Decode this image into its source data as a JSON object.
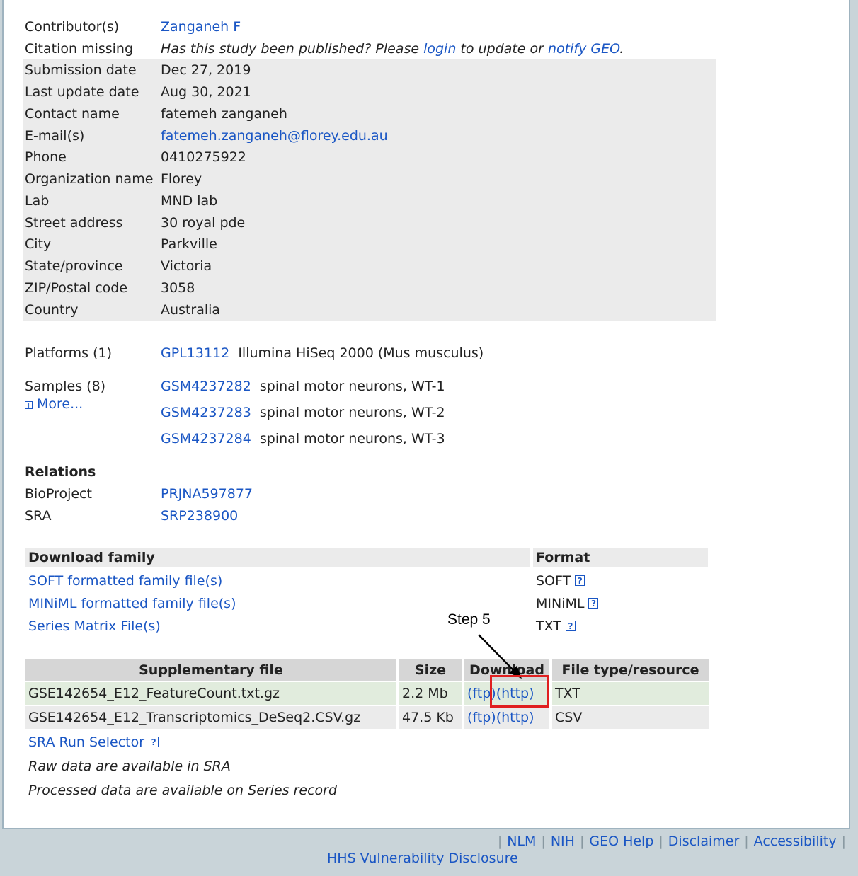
{
  "details": {
    "contributors_label": "Contributor(s)",
    "contributors_value": "Zanganeh F",
    "citation_label": "Citation missing",
    "citation_prefix": "Has this study been published? Please",
    "citation_login": "login",
    "citation_middle": "to update or",
    "citation_notify": "notify GEO",
    "citation_suffix": ".",
    "fields": [
      {
        "label": "Submission date",
        "value": "Dec 27, 2019"
      },
      {
        "label": "Last update date",
        "value": "Aug 30, 2021"
      },
      {
        "label": "Contact name",
        "value": "fatemeh zanganeh"
      },
      {
        "label": "E-mail(s)",
        "value": "fatemeh.zanganeh@florey.edu.au"
      },
      {
        "label": "Phone",
        "value": "0410275922"
      },
      {
        "label": "Organization name",
        "value": "Florey"
      },
      {
        "label": "Lab",
        "value": "MND lab"
      },
      {
        "label": "Street address",
        "value": "30 royal pde"
      },
      {
        "label": "City",
        "value": "Parkville"
      },
      {
        "label": "State/province",
        "value": "Victoria"
      },
      {
        "label": "ZIP/Postal code",
        "value": "3058"
      },
      {
        "label": "Country",
        "value": "Australia"
      }
    ]
  },
  "platforms": {
    "label": "Platforms (1)",
    "items": [
      {
        "id": "GPL13112",
        "desc": "Illumina HiSeq 2000 (Mus musculus)"
      }
    ]
  },
  "samples": {
    "label": "Samples (8)",
    "more": "More...",
    "items": [
      {
        "id": "GSM4237282",
        "desc": "spinal motor neurons, WT-1"
      },
      {
        "id": "GSM4237283",
        "desc": "spinal motor neurons, WT-2"
      },
      {
        "id": "GSM4237284",
        "desc": "spinal motor neurons, WT-3"
      }
    ]
  },
  "relations": {
    "heading": "Relations",
    "items": [
      {
        "label": "BioProject",
        "value": "PRJNA597877"
      },
      {
        "label": "SRA",
        "value": "SRP238900"
      }
    ]
  },
  "download_family": {
    "header": "Download family",
    "format_header": "Format",
    "rows": [
      {
        "label": "SOFT formatted family file(s)",
        "format": "SOFT"
      },
      {
        "label": "MINiML formatted family file(s)",
        "format": "MINiML"
      },
      {
        "label": "Series Matrix File(s)",
        "format": "TXT"
      }
    ]
  },
  "supplementary": {
    "headers": [
      "Supplementary file",
      "Size",
      "Download",
      "File type/resource"
    ],
    "rows": [
      {
        "file": "GSE142654_E12_FeatureCount.txt.gz",
        "size": "2.2 Mb",
        "ftp": "(ftp)",
        "http": "(http)",
        "type": "TXT"
      },
      {
        "file": "GSE142654_E12_Transcriptomics_DeSeq2.CSV.gz",
        "size": "47.5 Kb",
        "ftp": "(ftp)",
        "http": "(http)",
        "type": "CSV"
      }
    ],
    "sra_selector": "SRA Run Selector",
    "note1": "Raw data are available in SRA",
    "note2": "Processed data are available on Series record"
  },
  "annotation": {
    "label": "Step 5",
    "color": "#e02020"
  },
  "footer": {
    "links": [
      "NLM",
      "NIH",
      "GEO Help",
      "Disclaimer",
      "Accessibility"
    ],
    "hhs": "HHS Vulnerability Disclosure"
  },
  "help_glyph": "?",
  "plus_glyph": "+",
  "colors": {
    "link": "#1a56c4",
    "grey_band": "#ebebeb",
    "green_row": "#e1ecdd"
  }
}
